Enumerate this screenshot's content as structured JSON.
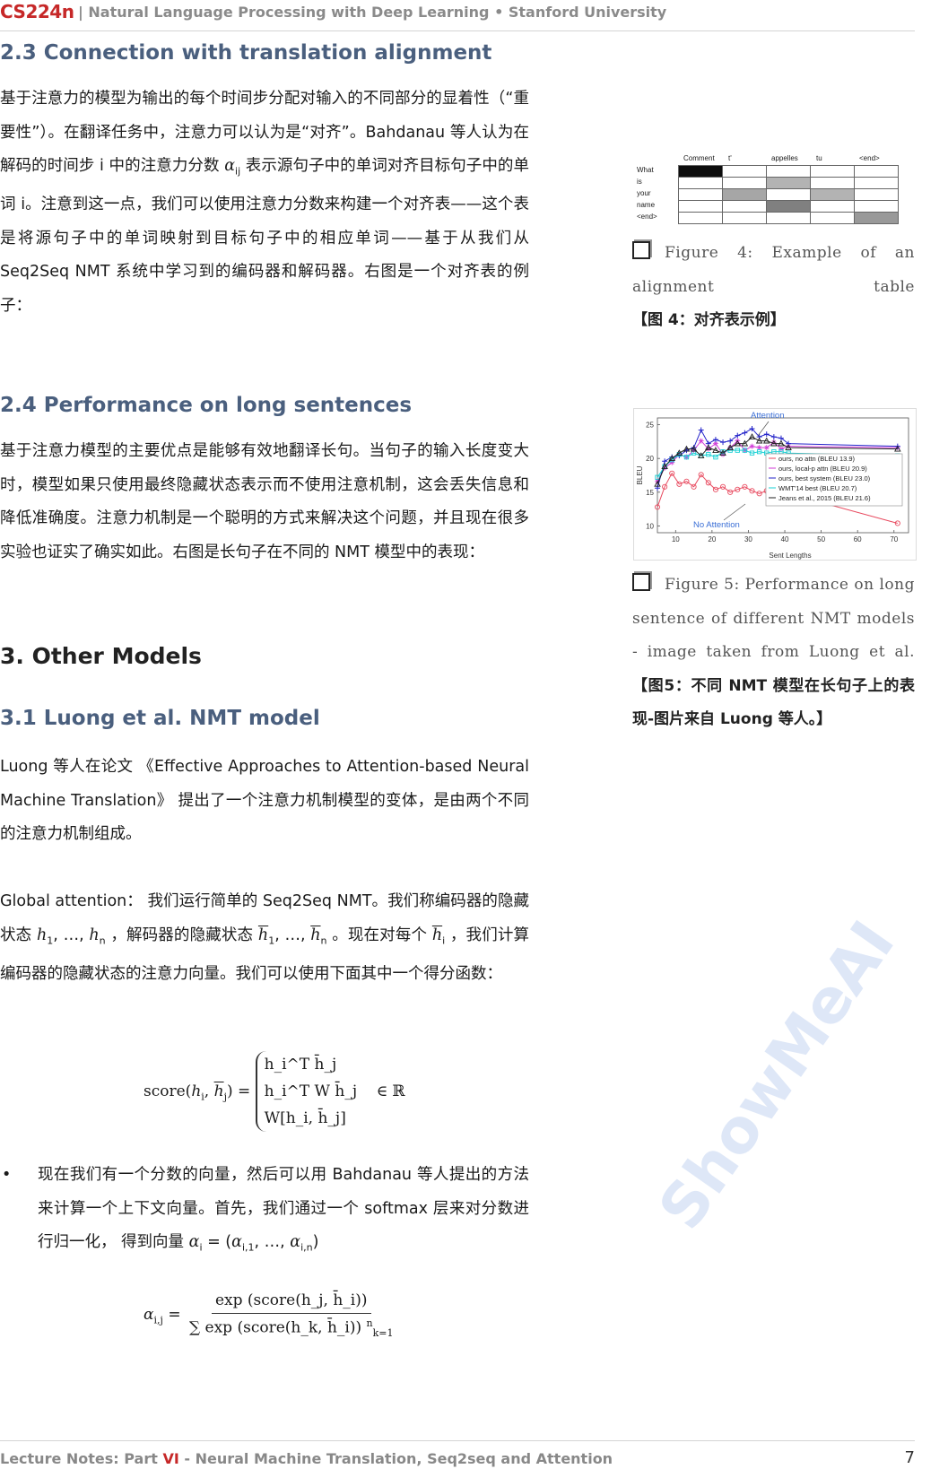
{
  "header": {
    "course": "CS224n",
    "subtitle": "| Natural Language Processing with Deep Learning • Stanford University"
  },
  "sec_2_3": {
    "title": "2.3 Connection with translation alignment",
    "p1": "基于注意力的模型为输出的每个时间步分配对输入的不同部分的显着性（“重要性”）。在翻译任务中，注意力可以认为是“对齐”。Bahdanau 等人认为在解码的时间步 i 中的注意力分数 ",
    "p1_alpha": "α",
    "p1_alpha_sub": "ij",
    "p1_tail": " 表示源句子中的单词对齐目标句子中的单词 i。注意到这一点，我们可以使用注意力分数来构建一个对齐表——这个表是将源句子中的单词映射到目标句子中的相应单词——基于从我们从 Seq2Seq NMT 系统中学习到的编码器和解码器。右图是一个对齐表的例子："
  },
  "sec_2_4": {
    "title": "2.4 Performance on long sentences",
    "p1": "基于注意力模型的主要优点是能够有效地翻译长句。当句子的输入长度变大时，模型如果只使用最终隐藏状态表示而不使用注意机制，这会丢失信息和降低准确度。注意力机制是一个聪明的方式来解决这个问题，并且现在很多实验也证实了确实如此。右图是长句子在不同的 NMT 模型中的表现："
  },
  "sec_3": {
    "title": "3.  Other Models"
  },
  "sec_3_1": {
    "title": "3.1 Luong et al. NMT model",
    "p1": "Luong 等人在论文 《Effective Approaches to Attention-based Neural Machine Translation》 提出了一个注意力机制模型的变体，是由两个不同的注意力机制组成。",
    "p2_a": "Global attention： 我们运行简单的 Seq2Seq NMT。我们称编码器的隐藏状态 ",
    "p2_h": "h",
    "p2_sub1": "1",
    "p2_ell": ", …, ",
    "p2_subn": "n",
    "p2_b": " ，解码器的隐藏状态 ",
    "p2_c": " 。现在对每个 ",
    "p2_subi": "i",
    "p2_d": " ，我们计算编码器的隐藏状态的注意力向量。我们可以使用下面其中一个得分函数：",
    "eq1_lhs": "score",
    "eq1_case1": "h_i^T h̄_j",
    "eq1_case2": "h_i^T W h̄_j",
    "eq1_case3": "W[h_i, h̄_j]",
    "eq1_set": "∈ ℝ",
    "bullet_dot": "•",
    "bullet": "现在我们有一个分数的向量，然后可以用 Bahdanau 等人提出的方法来计算一个上下文向量。首先，我们通过一个 softmax 层来对分数进行归一化， 得到向量 ",
    "bullet_alpha": "α",
    "bullet_eq": " = (",
    "bullet_vec_tail": ")",
    "eq2_lhs": "α",
    "eq2_lhs_sub": "i,j",
    "eq2_num": "exp (score(h_j, h̄_i))",
    "eq2_den": "∑ exp (score(h_k, h̄_i))",
    "eq2_sum_top": "n",
    "eq2_sum_bot": "k=1"
  },
  "figure4": {
    "columns": [
      "Comment",
      "t'",
      "appelles",
      "tu",
      "<end>"
    ],
    "rows": [
      "What",
      "is",
      "your",
      "name",
      "<end>"
    ],
    "weights": [
      [
        0.95,
        0,
        0,
        0,
        0
      ],
      [
        0,
        0,
        0.3,
        0,
        0
      ],
      [
        0,
        0.35,
        0,
        0.3,
        0
      ],
      [
        0,
        0,
        0.5,
        0,
        0
      ],
      [
        0,
        0,
        0,
        0,
        0.4
      ]
    ],
    "caption_label": "Figure 4: Example of an alignment table",
    "caption_zh": "【图 4：对齐表示例】"
  },
  "figure5": {
    "caption_label": "Figure 5: Performance on long sentence of different NMT models - image taken from Luong et al.",
    "caption_zh": "【图5：不同 NMT 模型在长句子上的表现-图片来自 Luong 等人。】"
  },
  "chart_data": {
    "type": "line",
    "xlabel": "Sent Lengths",
    "ylabel": "BLEU",
    "xlim": [
      5,
      74
    ],
    "ylim": [
      9,
      26
    ],
    "xticks": [
      10,
      20,
      30,
      40,
      50,
      60,
      70
    ],
    "yticks": [
      10,
      15,
      20,
      25
    ],
    "annotations": [
      {
        "text": "Attention",
        "color": "#3b6fd6"
      },
      {
        "text": "No Attention",
        "color": "#3b6fd6"
      }
    ],
    "legend_position": "lower-right",
    "series": [
      {
        "name": "ours, no attn (BLEU 13.9)",
        "color": "#e84a5f",
        "marker": "circle",
        "x": [
          5,
          7,
          9,
          11,
          13,
          15,
          17,
          19,
          21,
          23,
          25,
          27,
          29,
          31,
          33,
          35,
          37,
          39,
          41,
          71
        ],
        "y": [
          12.8,
          15.8,
          17.8,
          16.2,
          16.6,
          15.8,
          17.6,
          16.4,
          15.4,
          15.8,
          15.0,
          15.4,
          15.8,
          15.2,
          14.8,
          15.2,
          14.6,
          14.2,
          14.8,
          10.4
        ]
      },
      {
        "name": "ours, local-p attn (BLEU 20.9)",
        "color": "#d03bd6",
        "marker": "star",
        "x": [
          5,
          7,
          9,
          11,
          13,
          15,
          17,
          19,
          21,
          23,
          25,
          27,
          29,
          31,
          33,
          35,
          37,
          39,
          41,
          71
        ],
        "y": [
          16.6,
          18.6,
          19.4,
          20.6,
          20.2,
          21.2,
          22.6,
          21.4,
          22.2,
          20.6,
          21.6,
          22.6,
          21.2,
          21.8,
          21.6,
          21.6,
          22.4,
          21.4,
          21.8,
          21.6
        ]
      },
      {
        "name": "ours, best system (BLEU 23.0)",
        "color": "#2323c9",
        "marker": "plus",
        "x": [
          5,
          7,
          9,
          11,
          13,
          15,
          17,
          19,
          21,
          23,
          25,
          27,
          29,
          31,
          33,
          35,
          37,
          39,
          41,
          71
        ],
        "y": [
          15.6,
          19.6,
          20.2,
          20.4,
          21.2,
          21.6,
          24.2,
          22.2,
          22.8,
          22.4,
          22.6,
          23.4,
          23.8,
          24.4,
          23.2,
          23.6,
          23.2,
          23.0,
          22.2,
          21.8
        ]
      },
      {
        "name": "WMT'14 best (BLEU 20.7)",
        "color": "#19d0d4",
        "marker": "square",
        "x": [
          5,
          7,
          9,
          11,
          13,
          15,
          17,
          19,
          21,
          23,
          25,
          27,
          29,
          31,
          33,
          35,
          37,
          39,
          41,
          71
        ],
        "y": [
          17.2,
          18.8,
          19.8,
          20.6,
          20.2,
          20.8,
          20.4,
          20.6,
          20.2,
          21.0,
          21.2,
          21.2,
          21.2,
          20.8,
          21.0,
          20.8,
          21.0,
          21.0,
          20.8,
          20.4
        ]
      },
      {
        "name": "Jeans et al., 2015 (BLEU 21.6)",
        "color": "#222222",
        "marker": "triangle",
        "x": [
          5,
          7,
          9,
          11,
          13,
          15,
          17,
          19,
          21,
          23,
          25,
          27,
          29,
          31,
          33,
          35,
          37,
          39,
          41,
          71
        ],
        "y": [
          16.2,
          18.8,
          20.0,
          20.8,
          21.4,
          21.4,
          20.4,
          21.6,
          21.2,
          20.8,
          21.6,
          22.2,
          22.2,
          23.2,
          22.6,
          22.6,
          22.2,
          22.2,
          21.6,
          21.4
        ]
      }
    ]
  },
  "footer": {
    "prefix": "Lecture Notes: Part ",
    "part": "VI",
    "suffix": " - Neural Machine Translation, Seq2seq and Attention",
    "page": "7"
  },
  "watermark": "ShowMeAI"
}
